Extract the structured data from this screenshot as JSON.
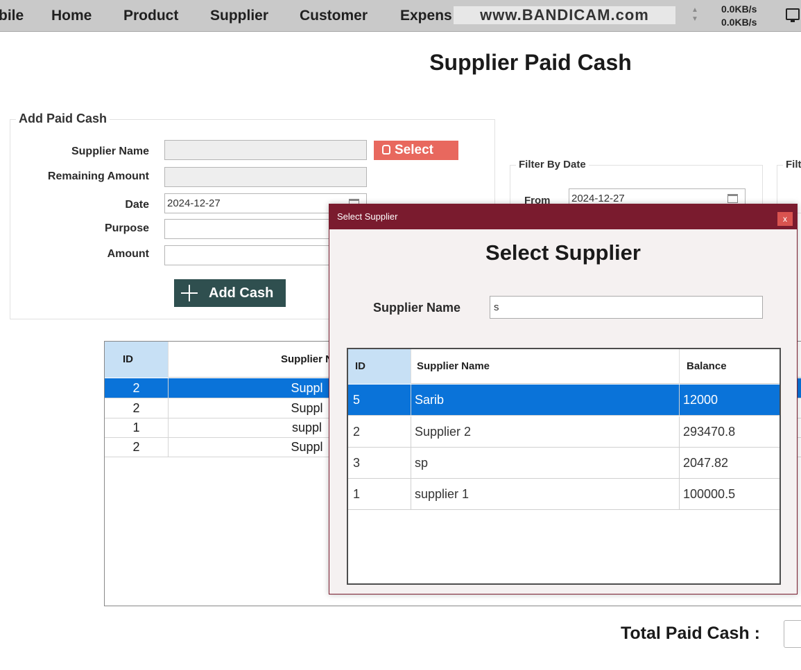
{
  "menubar": {
    "items": [
      "bile",
      "Home",
      "Product",
      "Supplier",
      "Customer",
      "Expens"
    ],
    "watermark": "www.BANDICAM.com",
    "net_up": "0.0KB/s",
    "net_down": "0.0KB/s"
  },
  "page": {
    "title": "Supplier Paid Cash"
  },
  "add_form": {
    "group_title": "Add Paid Cash",
    "supplier_name_label": "Supplier Name",
    "supplier_name_value": "",
    "remaining_label": "Remaining Amount",
    "remaining_value": "",
    "date_label": "Date",
    "date_value": "2024-12-27",
    "purpose_label": "Purpose",
    "purpose_value": "",
    "amount_label": "Amount",
    "amount_value": "",
    "select_button": "Select",
    "add_button": "Add Cash"
  },
  "filter": {
    "group_title": "Filter By Date",
    "from_label": "From",
    "from_value": "2024-12-27",
    "group2_title": "Filt"
  },
  "main_table": {
    "columns": [
      "ID",
      "Supplier N"
    ],
    "rows": [
      {
        "id": "2",
        "name": "Suppl"
      },
      {
        "id": "2",
        "name": "Suppl"
      },
      {
        "id": "1",
        "name": "suppl"
      },
      {
        "id": "2",
        "name": "Suppl"
      }
    ],
    "selected_row": 0
  },
  "total": {
    "label": "Total Paid Cash :",
    "value": ""
  },
  "dialog": {
    "window_title": "Select Supplier",
    "close_label": "x",
    "heading": "Select Supplier",
    "search_label": "Supplier Name",
    "search_value": "s",
    "columns": [
      "ID",
      "Supplier Name",
      "Balance"
    ],
    "rows": [
      {
        "id": "5",
        "name": "Sarib",
        "balance": "12000"
      },
      {
        "id": "2",
        "name": "Supplier 2",
        "balance": "293470.8"
      },
      {
        "id": "3",
        "name": "sp",
        "balance": "2047.82"
      },
      {
        "id": "1",
        "name": "supplier 1",
        "balance": "100000.5"
      }
    ],
    "selected_row": 0
  },
  "colors": {
    "menubar_bg": "#c9c9c9",
    "select_button": "#e8685e",
    "add_button": "#2f4f4f",
    "dialog_titlebar": "#7a1b2e",
    "selection": "#0a73d9",
    "id_header": "#c7e0f5"
  },
  "icons": {
    "select_button": "hand-pointer-icon",
    "add_button": "plus-icon",
    "date_picker": "calendar-icon",
    "tray": "monitor-icon",
    "dialog_close": "close-icon"
  }
}
